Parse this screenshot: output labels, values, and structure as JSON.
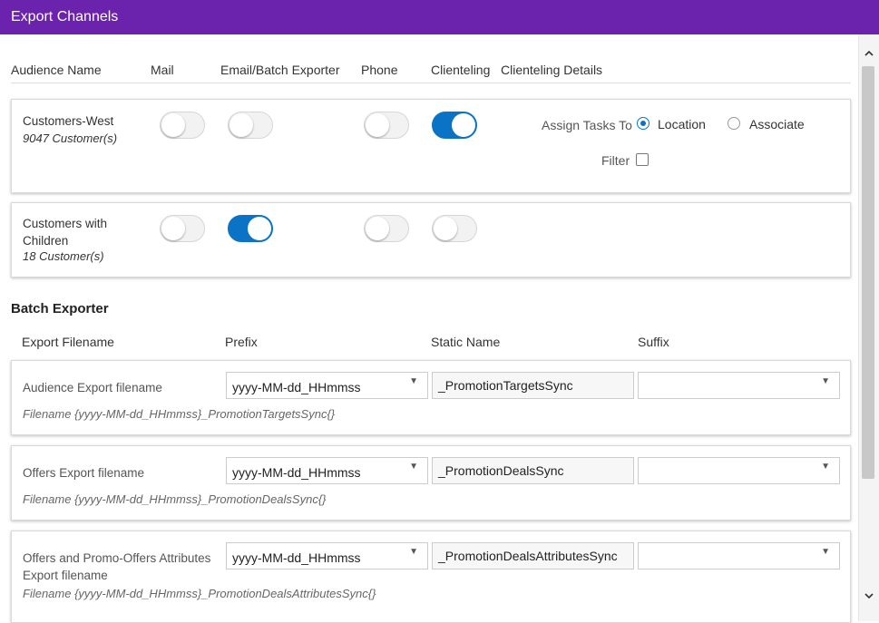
{
  "header": {
    "title": "Export Channels"
  },
  "columns": {
    "audience_name": "Audience Name",
    "mail": "Mail",
    "email_batch": "Email/Batch Exporter",
    "phone": "Phone",
    "clienteling": "Clienteling",
    "clienteling_details": "Clienteling Details"
  },
  "audiences": [
    {
      "name": "Customers-West",
      "count": "9047 Customer(s)",
      "mail": false,
      "email_batch": false,
      "phone": false,
      "clienteling": true
    },
    {
      "name_line1": "Customers with",
      "name_line2": "Children",
      "count": "18 Customer(s)",
      "mail": false,
      "email_batch": true,
      "phone": false,
      "clienteling": false
    }
  ],
  "clienteling_details": {
    "assign_tasks_label": "Assign Tasks To",
    "location_label": "Location",
    "associate_label": "Associate",
    "selected": "Location",
    "filter_label": "Filter",
    "filter_checked": false
  },
  "batch_exporter": {
    "title": "Batch Exporter",
    "headers": {
      "export_filename": "Export Filename",
      "prefix": "Prefix",
      "static_name": "Static Name",
      "suffix": "Suffix"
    },
    "rows": [
      {
        "label": "Audience Export filename",
        "prefix": "yyyy-MM-dd_HHmmss",
        "static_name": "_PromotionTargetsSync",
        "suffix": "",
        "preview": "Filename {yyyy-MM-dd_HHmmss}_PromotionTargetsSync{}"
      },
      {
        "label": "Offers Export filename",
        "prefix": "yyyy-MM-dd_HHmmss",
        "static_name": "_PromotionDealsSync",
        "suffix": "",
        "preview": "Filename {yyyy-MM-dd_HHmmss}_PromotionDealsSync{}"
      },
      {
        "label_line1": "Offers and Promo-Offers Attributes",
        "label_line2": "Export filename",
        "prefix": "yyyy-MM-dd_HHmmss",
        "static_name": "_PromotionDealsAttributesSync",
        "suffix": "",
        "preview": "Filename {yyyy-MM-dd_HHmmss}_PromotionDealsAttributesSync{}"
      }
    ]
  },
  "icons": {
    "scroll_up": "chevron-up-icon",
    "scroll_down": "chevron-down-icon",
    "dropdown": "caret-down-icon"
  },
  "colors": {
    "header_bg": "#6b22ad",
    "toggle_on": "#0b73c6"
  }
}
